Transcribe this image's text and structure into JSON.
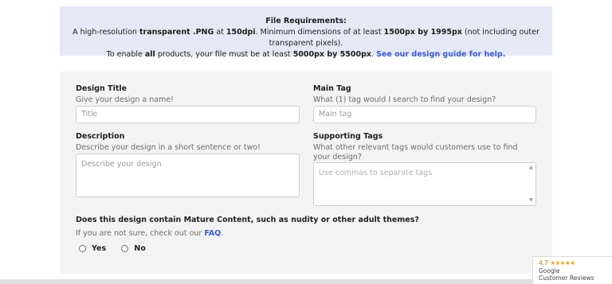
{
  "requirements": {
    "title": "File Requirements:",
    "line1": {
      "t1": "A high-resolution ",
      "b1": "transparent .PNG",
      "t2": " at ",
      "b2": "150dpi",
      "t3": ". Minimum dimensions of at least ",
      "b3": "1500px by 1995px",
      "t4": " (not including outer transparent pixels)."
    },
    "line2": {
      "t1": "To enable ",
      "b1": "all",
      "t2": " products, your file must be at least ",
      "b2": "5000px by 5500px",
      "t3": ". ",
      "link": "See our design guide for help."
    }
  },
  "form": {
    "design_title": {
      "label": "Design Title",
      "hint": "Give your design a name!",
      "placeholder": "Title"
    },
    "main_tag": {
      "label": "Main Tag",
      "hint": "What (1) tag would I search to find your design?",
      "placeholder": "Main tag"
    },
    "description": {
      "label": "Description",
      "hint": "Describe your design in a short sentence or two!",
      "placeholder": "Describe your design"
    },
    "supporting_tags": {
      "label": "Supporting Tags",
      "hint": "What other relevant tags would customers use to find your design?",
      "placeholder": "Use commas to separate tags"
    },
    "mature": {
      "question": "Does this design contain Mature Content, such as nudity or other adult themes?",
      "hint": "If you are not sure, check out our ",
      "faq": "FAQ",
      "hint_end": ".",
      "options": [
        "Yes",
        "No"
      ]
    }
  },
  "reviews_badge": {
    "rating": "4.7",
    "stars": "★★★★★",
    "line1": "Google",
    "line2": "Customer Reviews"
  },
  "colors": {
    "banner": "#e6e8f6",
    "panel": "#f3f3f3",
    "link": "#3b5bdb",
    "star": "#f2a100"
  }
}
